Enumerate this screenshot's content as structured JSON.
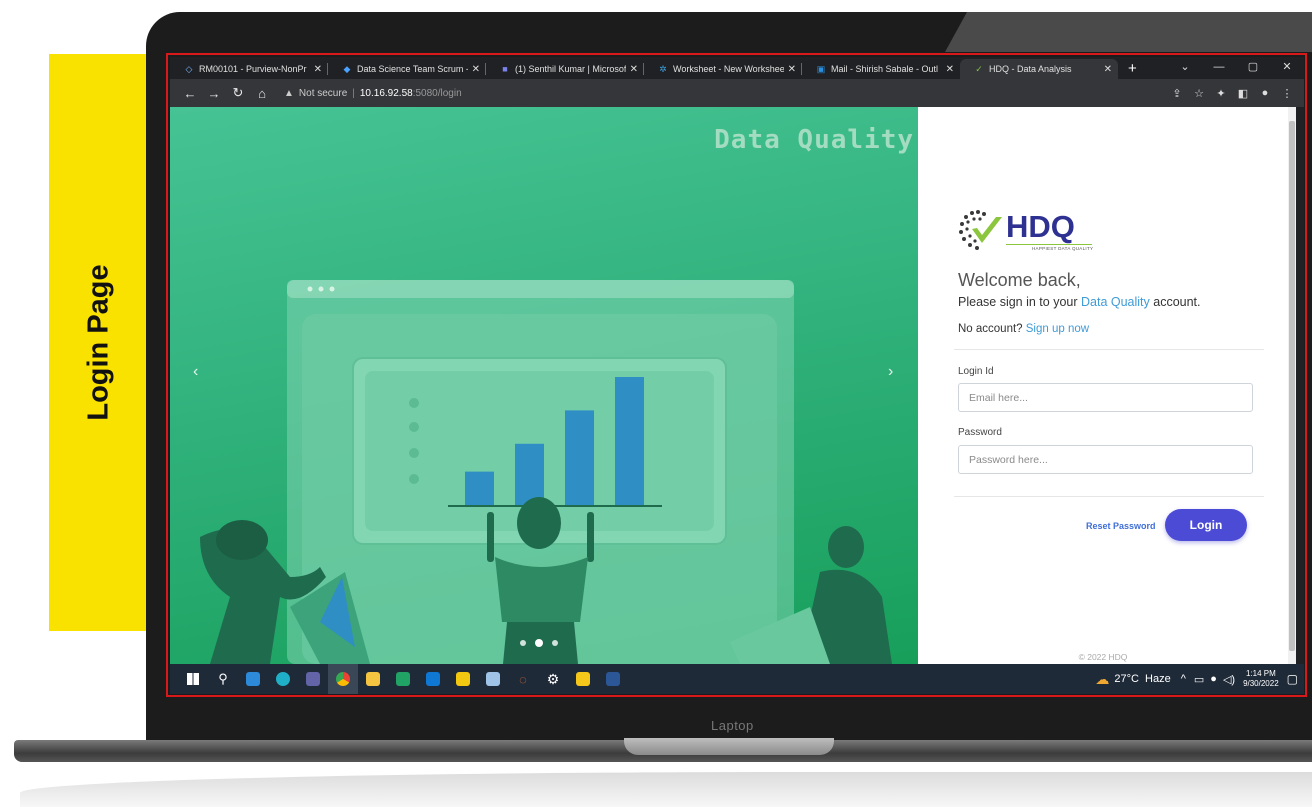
{
  "side_label": "Login Page",
  "laptop_label": "Laptop",
  "browser": {
    "tabs": [
      {
        "title": "RM00101 - Purview-NonPr",
        "icon": "purview-icon",
        "color": "#7ab8ff",
        "glyph": "◇"
      },
      {
        "title": "Data Science Team Scrum -",
        "icon": "azure-devops-icon",
        "color": "#4aa3ff",
        "glyph": "◆"
      },
      {
        "title": "(1) Senthil Kumar | Microsof",
        "icon": "teams-icon",
        "color": "#7b83eb",
        "glyph": "■"
      },
      {
        "title": "Worksheet - New Workshee",
        "icon": "worksheet-icon",
        "color": "#3aa0e0",
        "glyph": "✲"
      },
      {
        "title": "Mail - Shirish Sabale - Outl",
        "icon": "outlook-icon",
        "color": "#2a8fde",
        "glyph": "▣"
      },
      {
        "title": "HDQ - Data Analysis",
        "icon": "hdq-icon",
        "color": "#7cc04a",
        "glyph": "✓"
      }
    ],
    "new_tab": "+",
    "url": {
      "warning": "Not secure",
      "host": "10.16.92.58",
      "path": ":5080/login"
    }
  },
  "hero": {
    "title": "Data Quality",
    "chart_data": {
      "type": "bar",
      "values": [
        1.2,
        2.2,
        3.4,
        4.6
      ]
    },
    "colors": {
      "bar": "#2f8fc4",
      "figure_dark": "#1f6b4e",
      "figure_shirt": "#2e8a62"
    }
  },
  "login": {
    "brand": "HDQ",
    "brand_tagline": "HAPPIEST DATA QUALITY",
    "welcome": "Welcome back,",
    "signin_prefix": "Please sign in to your ",
    "signin_link": "Data Quality",
    "signin_suffix": " account.",
    "no_account": "No account? ",
    "signup_link": "Sign up now",
    "login_id_label": "Login Id",
    "login_id_placeholder": "Email here...",
    "password_label": "Password",
    "password_placeholder": "Password here...",
    "reset_link": "Reset Password",
    "login_button": "Login",
    "copyright": "© 2022 HDQ"
  },
  "taskbar": {
    "apps": [
      {
        "icon": "windows-start-icon",
        "color": "#ffffff"
      },
      {
        "icon": "search-icon",
        "color": "#ffffff"
      },
      {
        "icon": "mail-icon",
        "color": "#2c8ad8"
      },
      {
        "icon": "edge-icon",
        "color": "#1fb0c8"
      },
      {
        "icon": "teams-icon",
        "color": "#6264a7"
      },
      {
        "icon": "chrome-icon",
        "color": "#f2a12b"
      },
      {
        "icon": "file-explorer-icon",
        "color": "#f5c542"
      },
      {
        "icon": "excel-icon",
        "color": "#21a366"
      },
      {
        "icon": "outlook-icon",
        "color": "#0f78d4"
      },
      {
        "icon": "power-bi-icon",
        "color": "#f2c811"
      },
      {
        "icon": "pen-icon",
        "color": "#9fc4e8"
      },
      {
        "icon": "jupyter-icon",
        "color": "#e46e2e"
      },
      {
        "icon": "settings-icon",
        "color": "#ffffff"
      },
      {
        "icon": "sticky-notes-icon",
        "color": "#f5c71a"
      },
      {
        "icon": "word-icon",
        "color": "#2b5797"
      }
    ],
    "weather": "27°C  Haze",
    "time": "1:14 PM",
    "date": "9/30/2022"
  }
}
